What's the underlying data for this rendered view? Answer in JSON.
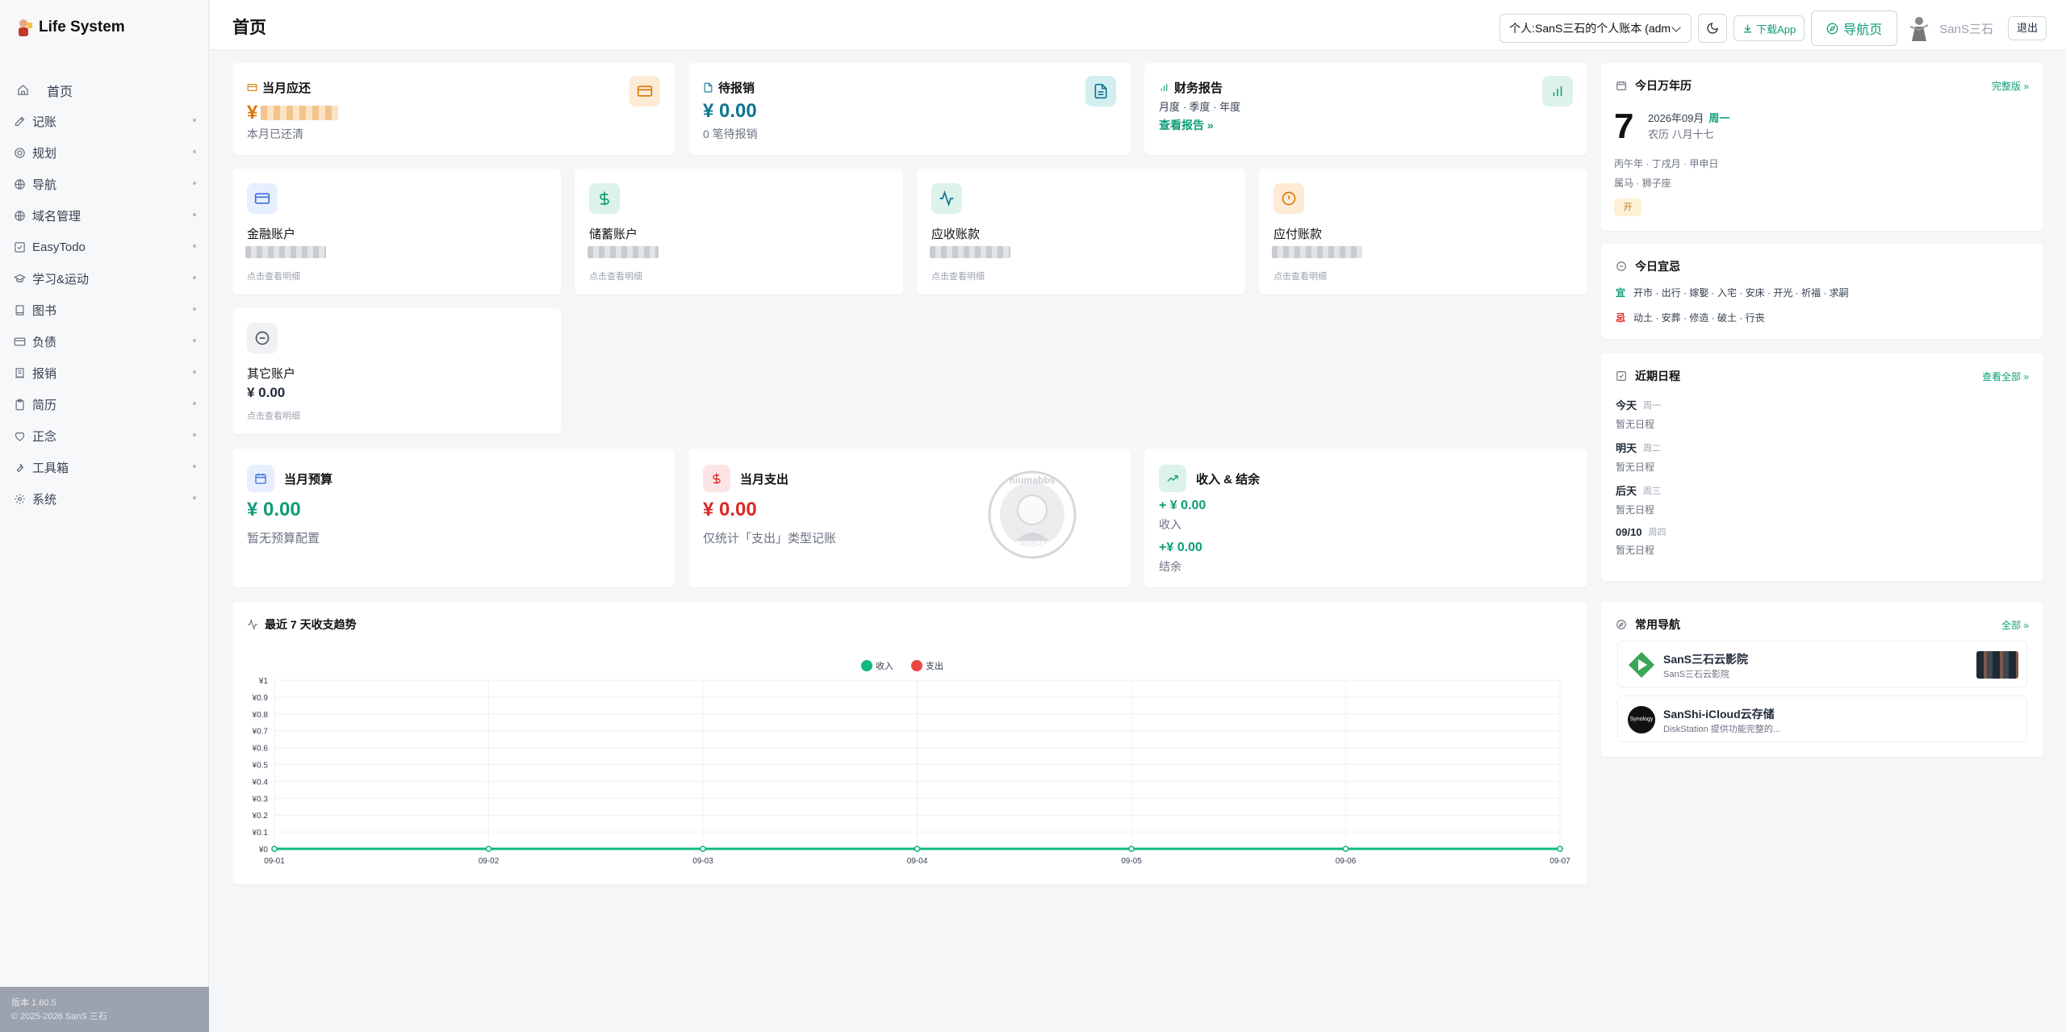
{
  "app": {
    "title": "Life System",
    "version": "版本 1.60.5",
    "copyright": "© 2025-2026 SanS 三石"
  },
  "sidebar": {
    "items": [
      {
        "label": "首页",
        "icon": "home-icon"
      },
      {
        "label": "记账",
        "icon": "edit-icon"
      },
      {
        "label": "规划",
        "icon": "target-icon"
      },
      {
        "label": "导航",
        "icon": "globe-icon"
      },
      {
        "label": "域名管理",
        "icon": "globe-icon"
      },
      {
        "label": "EasyTodo",
        "icon": "checkbox-icon"
      },
      {
        "label": "学习&运动",
        "icon": "graduation-icon"
      },
      {
        "label": "图书",
        "icon": "book-icon"
      },
      {
        "label": "负债",
        "icon": "card-icon"
      },
      {
        "label": "报销",
        "icon": "receipt-icon"
      },
      {
        "label": "简历",
        "icon": "clipboard-icon"
      },
      {
        "label": "正念",
        "icon": "heart-icon"
      },
      {
        "label": "工具箱",
        "icon": "wrench-icon"
      },
      {
        "label": "系统",
        "icon": "gear-icon"
      }
    ]
  },
  "header": {
    "title": "首页",
    "ledger_select": "个人:SanS三石的个人账本 (adm",
    "download": "下载App",
    "nav_page": "导航页",
    "username": "SanS三石",
    "logout": "退出"
  },
  "cards": {
    "monthly_due": {
      "title": "当月应还",
      "currency": "¥",
      "sub": "本月已还清"
    },
    "pending_reimb": {
      "title": "待报销",
      "amount": "¥ 0.00",
      "sub": "0 笔待报销"
    },
    "finance_report": {
      "title": "财务报告",
      "sub": "月度 · 季度 · 年度",
      "link": "查看报告 »"
    },
    "accounts": [
      {
        "title": "金融账户",
        "hint": "点击查看明细",
        "icon": "credit-card-icon"
      },
      {
        "title": "储蓄账户",
        "hint": "点击查看明细",
        "icon": "dollar-icon"
      },
      {
        "title": "应收账款",
        "hint": "点击查看明细",
        "icon": "activity-icon"
      },
      {
        "title": "应付账款",
        "hint": "点击查看明细",
        "icon": "alert-circle-icon"
      }
    ],
    "other_account": {
      "title": "其它账户",
      "amount": "¥ 0.00",
      "hint": "点击查看明细"
    },
    "budget": {
      "title": "当月预算",
      "amount": "¥ 0.00",
      "sub": "暂无预算配置"
    },
    "expense": {
      "title": "当月支出",
      "amount": "¥ 0.00",
      "sub": "仅统计「支出」类型记账"
    },
    "income_balance": {
      "title": "收入 & 结余",
      "income": "+ ¥ 0.00",
      "income_label": "收入",
      "balance": "+¥ 0.00",
      "balance_label": "结余"
    },
    "trend": {
      "title": "最近 7 天收支趋势"
    }
  },
  "watermark": {
    "top": "niumabbs",
    "bottom": "牛马论坛"
  },
  "chart_data": {
    "type": "line",
    "x": [
      "09-01",
      "09-02",
      "09-03",
      "09-04",
      "09-05",
      "09-06",
      "09-07"
    ],
    "series": [
      {
        "name": "收入",
        "values": [
          0,
          0,
          0,
          0,
          0,
          0,
          0
        ],
        "color": "#10b981"
      },
      {
        "name": "支出",
        "values": [
          0,
          0,
          0,
          0,
          0,
          0,
          0
        ],
        "color": "#ef4444"
      }
    ],
    "yticks": [
      "¥0",
      "¥0.1",
      "¥0.2",
      "¥0.3",
      "¥0.4",
      "¥0.5",
      "¥0.6",
      "¥0.7",
      "¥0.8",
      "¥0.9",
      "¥1"
    ],
    "ylim": [
      0,
      1
    ],
    "legend": "top-center",
    "grid": true
  },
  "calendar": {
    "title": "今日万年历",
    "full_link": "完整版 »",
    "day": "7",
    "date": "2026年09月",
    "weekday": "周一",
    "lunar": "农历 八月十七",
    "ganzhi": "丙午年 · 丁戌月 · 甲申日",
    "zodiac": "属马 · 狮子座",
    "badge": "开"
  },
  "yiji": {
    "title": "今日宜忌",
    "yi_label": "宜",
    "yi": "开市 · 出行 · 嫁娶 · 入宅 · 安床 · 开光 · 祈福 · 求嗣",
    "ji_label": "忌",
    "ji": "动土 · 安葬 · 修造 · 破土 · 行丧"
  },
  "schedule": {
    "title": "近期日程",
    "all_link": "查看全部 »",
    "items": [
      {
        "day": "今天",
        "week": "周一",
        "text": "暂无日程"
      },
      {
        "day": "明天",
        "week": "周二",
        "text": "暂无日程"
      },
      {
        "day": "后天",
        "week": "周三",
        "text": "暂无日程"
      },
      {
        "day": "09/10",
        "week": "周四",
        "text": "暂无日程"
      }
    ]
  },
  "common_nav": {
    "title": "常用导航",
    "all_link": "全部 »",
    "items": [
      {
        "name": "SanS三石云影院",
        "desc": "SanS三石云影院"
      },
      {
        "name": "SanShi-iCloud云存储",
        "desc": "DiskStation 提供功能完整的...",
        "logo": "Synology"
      }
    ]
  },
  "colors": {
    "accent": "#0f9d77",
    "danger": "#dc2626",
    "warning": "#d97706"
  }
}
